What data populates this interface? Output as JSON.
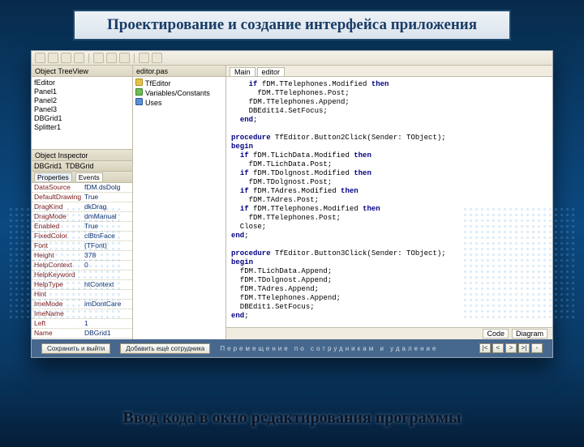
{
  "title": "Проектирование и создание интерфейса приложения",
  "caption": "Ввод кода в окно редактирования  программы",
  "panes": {
    "objectTreeView": "Object TreeView",
    "inspector": "Object Inspector"
  },
  "classTree": {
    "root": "fEditor",
    "items": [
      "Panel1",
      "Panel2",
      "Panel3",
      "   DBGrid1",
      "Splitter1"
    ]
  },
  "inspectorHeader": {
    "sel1": "DBGrid1",
    "sel2": "TDBGrid"
  },
  "inspectorTabs": [
    "Properties",
    "Events"
  ],
  "props": [
    {
      "n": "DataSource",
      "v": "fDM.dsDolg"
    },
    {
      "n": "DefaultDrawing",
      "v": "True"
    },
    {
      "n": "DragKind",
      "v": "dkDrag"
    },
    {
      "n": "DragMode",
      "v": "dmManual"
    },
    {
      "n": "Enabled",
      "v": "True"
    },
    {
      "n": "FixedColor",
      "v": "clBtnFace"
    },
    {
      "n": "Font",
      "v": "(TFont)"
    },
    {
      "n": "Height",
      "v": "378"
    },
    {
      "n": "HelpContext",
      "v": "0"
    },
    {
      "n": "HelpKeyword",
      "v": ""
    },
    {
      "n": "HelpType",
      "v": "htContext"
    },
    {
      "n": "Hint",
      "v": ""
    },
    {
      "n": "ImeMode",
      "v": "imDontCare"
    },
    {
      "n": "ImeName",
      "v": ""
    },
    {
      "n": "Left",
      "v": "1"
    },
    {
      "n": "Name",
      "v": "DBGrid1"
    }
  ],
  "projectTree": {
    "tab": "editor.pas",
    "items": [
      {
        "ico": "yel",
        "label": "TfEditor"
      },
      {
        "ico": "grn",
        "label": "Variables/Constants"
      },
      {
        "ico": "blu",
        "label": "Uses"
      }
    ]
  },
  "codeTabs": {
    "main": "Main",
    "editor": "editor"
  },
  "code": [
    "    if fDM.TTelephones.Modified then",
    "      fDM.TTelephones.Post;",
    "    fDM.TTelephones.Append;",
    "    DBEdit14.SetFocus;",
    "  end;",
    "",
    "procedure TfEditor.Button2Click(Sender: TObject);",
    "begin",
    "  if fDM.TLichData.Modified then",
    "    fDM.TLichData.Post;",
    "  if fDM.TDolgnost.Modified then",
    "    fDM.TDolgnost.Post;",
    "  if fDM.TAdres.Modified then",
    "    fDM.TAdres.Post;",
    "  if fDM.TTelephones.Modified then",
    "    fDM.TTelephones.Post;",
    "  Close;",
    "end;",
    "",
    "procedure TfEditor.Button3Click(Sender: TObject);",
    "begin",
    "  fDM.TLichData.Append;",
    "  fDM.TDolgnost.Append;",
    "  fDM.TAdres.Append;",
    "  fDM.TTelephones.Append;",
    "  DBEdit1.SetFocus;",
    "end;"
  ],
  "codeFooterTabs": [
    "Code",
    "Diagram"
  ],
  "modal": {
    "btn1": "Сохранить и выйти",
    "btn2": "Добавить ещё сотрудника",
    "note": "Перемещение по сотрудникам и удаление",
    "nav": [
      "|<",
      "<",
      ">",
      ">|",
      "-"
    ]
  }
}
